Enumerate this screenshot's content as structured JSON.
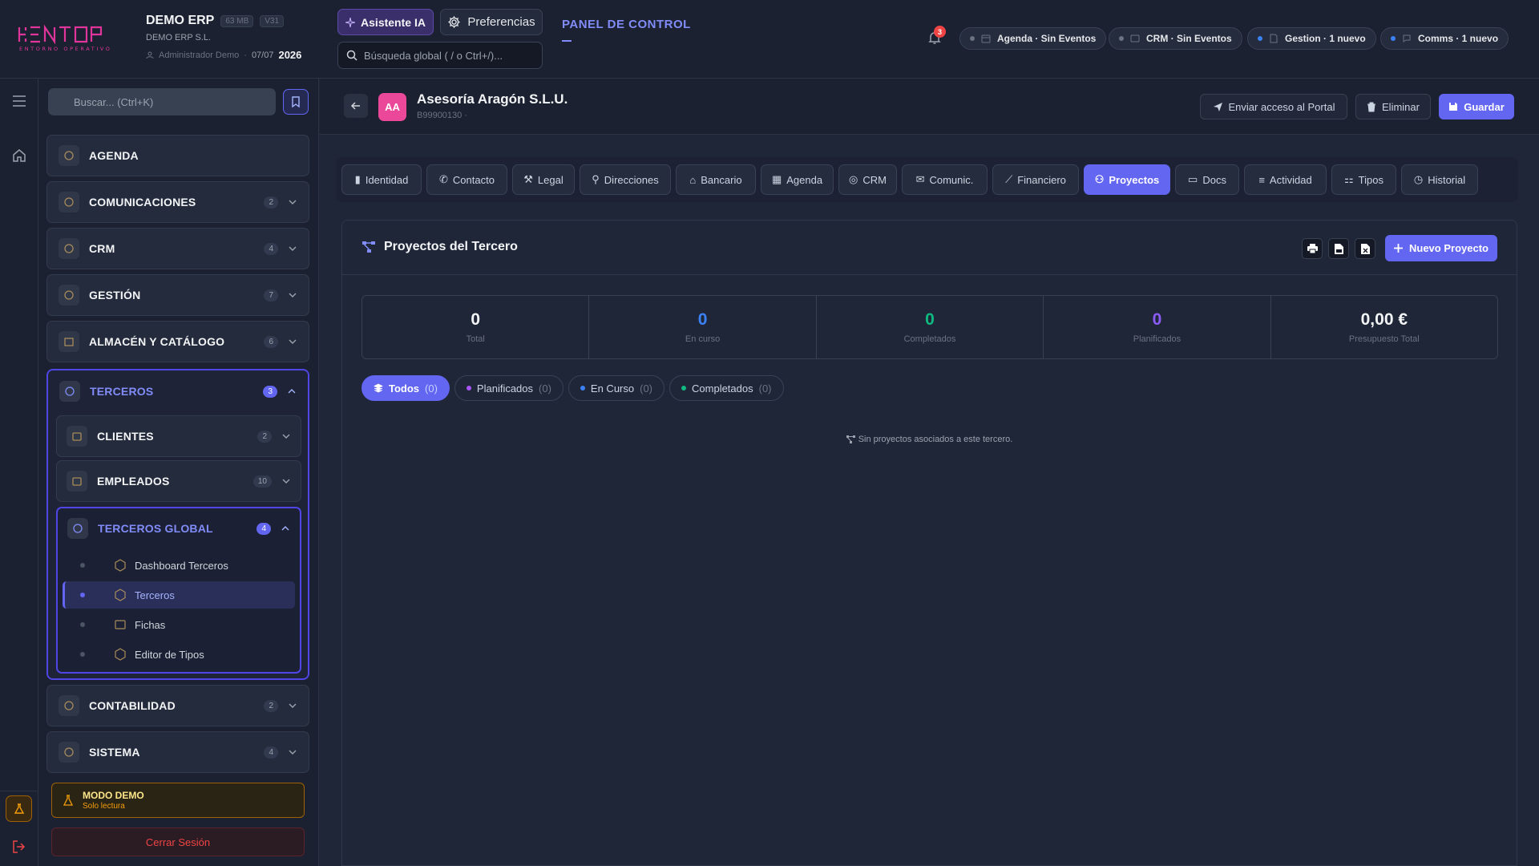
{
  "app": {
    "name": "DEMO ERP",
    "size_chip": "63 MB",
    "version_chip": "V31",
    "company": "DEMO ERP S.L.",
    "user": "Administrador Demo",
    "date": "07/07",
    "year": "2026",
    "logo_text": "KENTOP",
    "logo_tagline": "ENTORNO OPERATIVO"
  },
  "topbar": {
    "ai_button": "Asistente IA",
    "prefs_button": "Preferencias",
    "search_placeholder": "Búsqueda global ( / o Ctrl+/)...",
    "panel_title": "PANEL DE CONTROL",
    "notifications_count": "3",
    "status": [
      {
        "label": "Agenda · Sin Eventos",
        "dot": "#6b7280"
      },
      {
        "label": "CRM · Sin Eventos",
        "dot": "#6b7280"
      },
      {
        "label": "Gestion · 1 nuevo",
        "dot": "#3b82f6"
      },
      {
        "label": "Comms · 1 nuevo",
        "dot": "#3b82f6"
      }
    ]
  },
  "sidebar": {
    "search_placeholder": "Buscar... (Ctrl+K)",
    "sections": [
      {
        "label": "AGENDA",
        "count": ""
      },
      {
        "label": "COMUNICACIONES",
        "count": "2"
      },
      {
        "label": "CRM",
        "count": "4"
      },
      {
        "label": "GESTIÓN",
        "count": "7"
      },
      {
        "label": "ALMACÉN Y CATÁLOGO",
        "count": "6"
      }
    ],
    "open_section": {
      "label": "TERCEROS",
      "count": "3",
      "subs": [
        {
          "label": "CLIENTES",
          "count": "2"
        },
        {
          "label": "EMPLEADOS",
          "count": "10"
        }
      ],
      "open_sub": {
        "label": "TERCEROS GLOBAL",
        "count": "4",
        "items": [
          "Dashboard Terceros",
          "Terceros",
          "Fichas",
          "Editor de Tipos"
        ],
        "active_item": "Terceros"
      }
    },
    "bottom_sections": [
      {
        "label": "CONTABILIDAD",
        "count": "2"
      },
      {
        "label": "SISTEMA",
        "count": "4"
      }
    ],
    "demo_title": "MODO DEMO",
    "demo_sub": "Solo lectura",
    "logout": "Cerrar Sesión"
  },
  "entity": {
    "initials": "AA",
    "name": "Asesoría Aragón S.L.U.",
    "id": "B99900130 ·",
    "actions": {
      "portal": "Enviar acceso al Portal",
      "delete": "Eliminar",
      "save": "Guardar"
    }
  },
  "tabs": [
    "Identidad",
    "Contacto",
    "Legal",
    "Direcciones",
    "Bancario",
    "Agenda",
    "CRM",
    "Comunic.",
    "Financiero",
    "Proyectos",
    "Docs",
    "Actividad",
    "Tipos",
    "Historial"
  ],
  "active_tab": "Proyectos",
  "projects": {
    "title": "Proyectos del Tercero",
    "new_button": "Nuevo Proyecto",
    "stats": [
      {
        "value": "0",
        "label": "Total",
        "color": "#f3f4f6"
      },
      {
        "value": "0",
        "label": "En curso",
        "color": "#3b82f6"
      },
      {
        "value": "0",
        "label": "Completados",
        "color": "#10b981"
      },
      {
        "value": "0",
        "label": "Planificados",
        "color": "#8b5cf6"
      },
      {
        "value": "0,00 €",
        "label": "Presupuesto Total",
        "color": "#f3f4f6"
      }
    ],
    "filters": [
      {
        "label": "Todos",
        "count": "(0)",
        "dot": ""
      },
      {
        "label": "Planificados",
        "count": "(0)",
        "dot": "#a855f7"
      },
      {
        "label": "En Curso",
        "count": "(0)",
        "dot": "#3b82f6"
      },
      {
        "label": "Completados",
        "count": "(0)",
        "dot": "#10b981"
      }
    ],
    "empty_text": "Sin proyectos asociados a este tercero."
  },
  "colors": {
    "accent": "#6366f1",
    "brand": "#e0369c"
  }
}
